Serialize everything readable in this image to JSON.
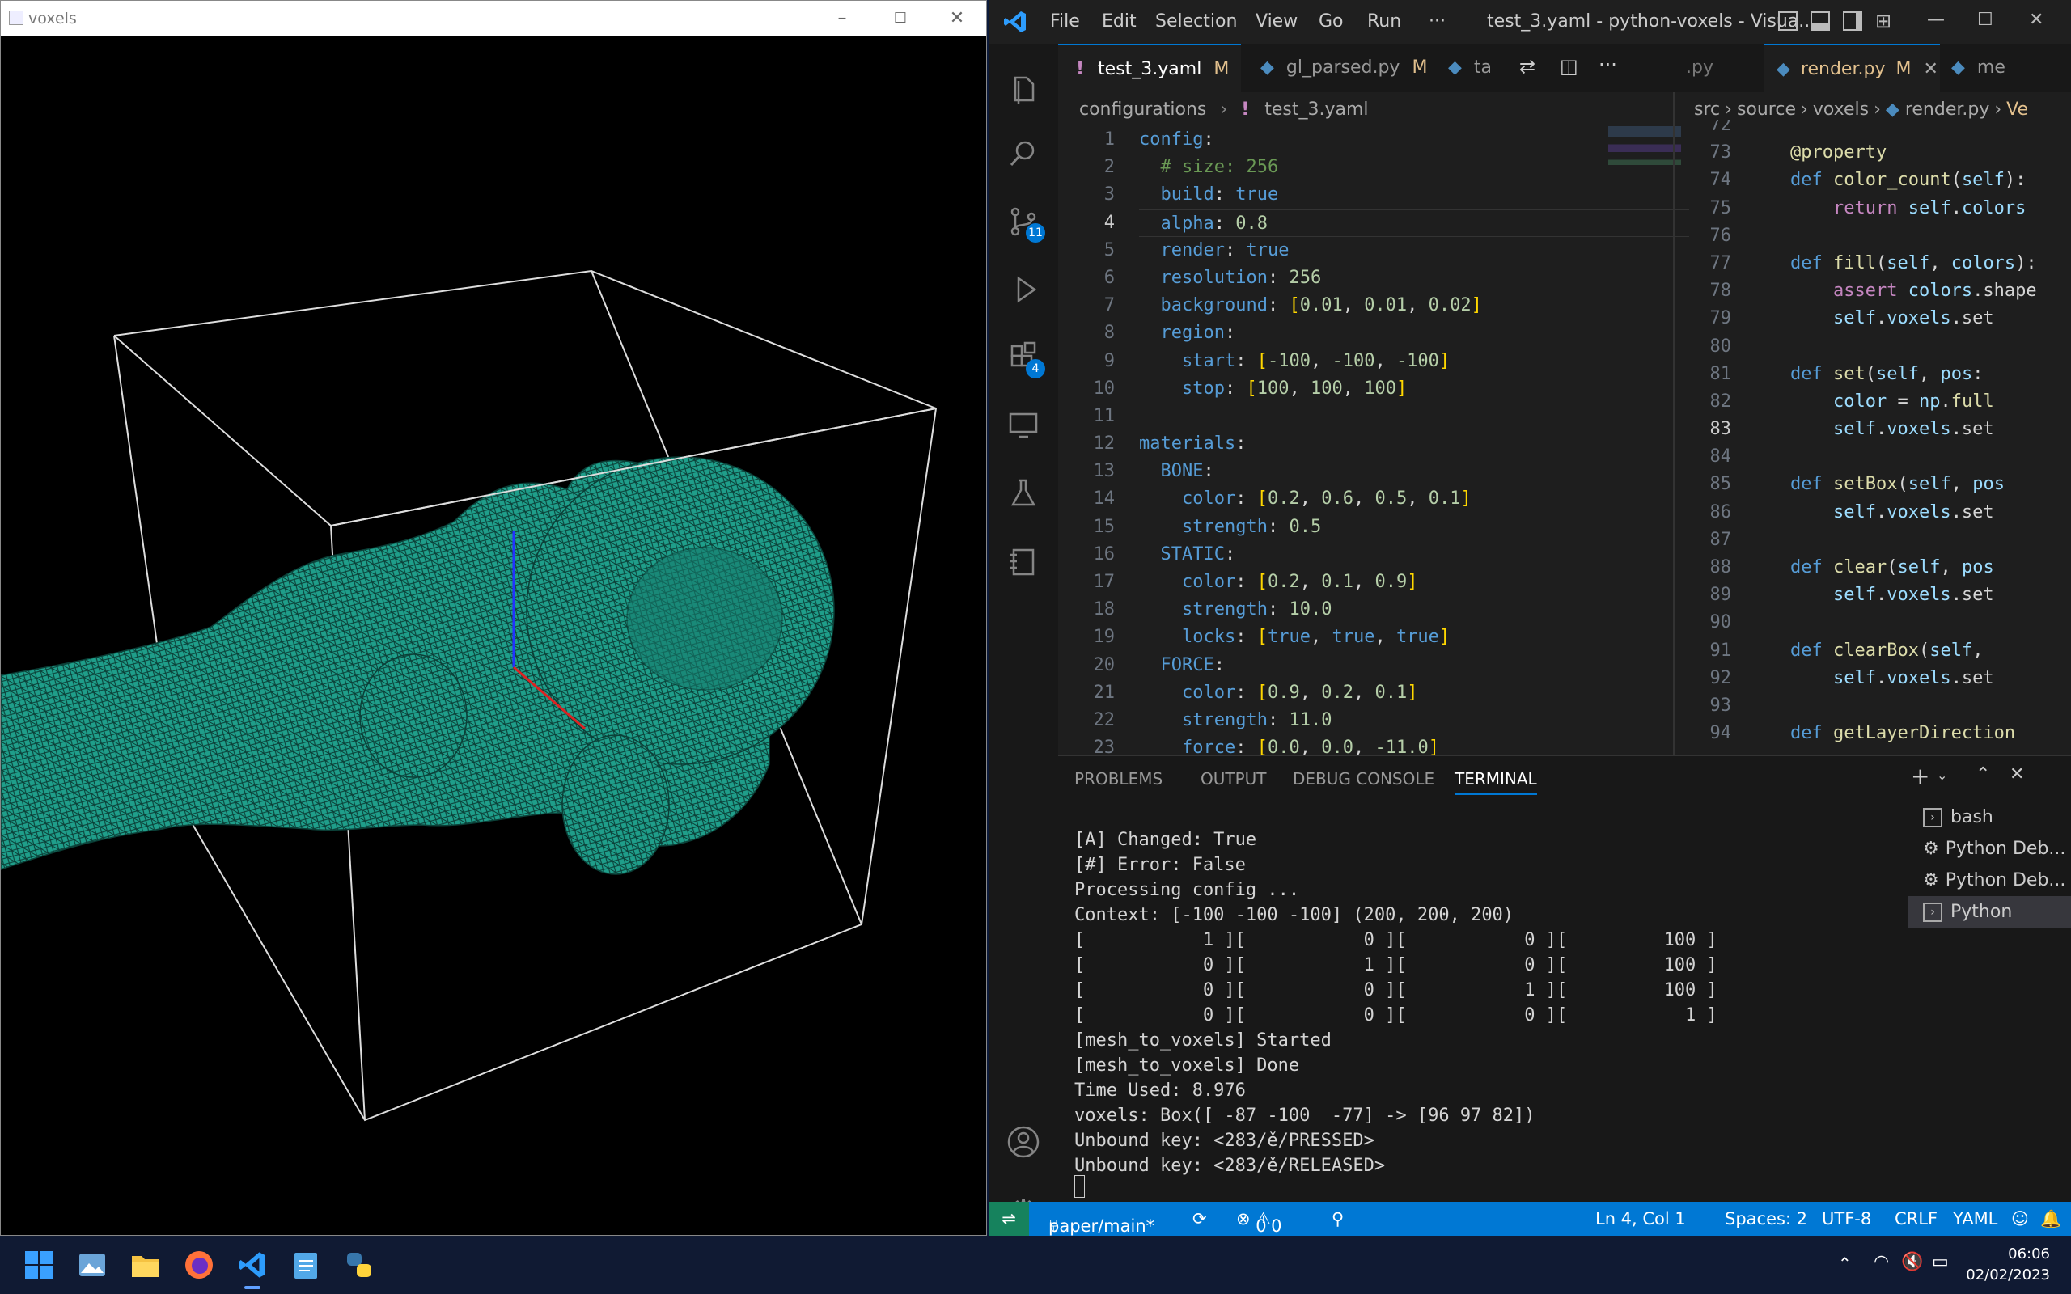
{
  "voxels_window": {
    "title": "voxels",
    "minimize": "–",
    "maximize": "☐",
    "close": "✕"
  },
  "vscode": {
    "menu": [
      "File",
      "Edit",
      "Selection",
      "View",
      "Go",
      "Run",
      "···"
    ],
    "title": "test_3.yaml - python-voxels - Visua...",
    "left_tabs": [
      {
        "icon": "!",
        "label": "test_3.yaml",
        "status": "M",
        "active": true
      },
      {
        "icon": "py",
        "label": "gl_parsed.py",
        "status": "M",
        "active": false
      },
      {
        "icon": "py",
        "label": "ta",
        "status": "",
        "active": false
      }
    ],
    "right_tabs": [
      {
        "label": ".py"
      },
      {
        "label": "render.py",
        "status": "M",
        "active": true
      },
      {
        "label": "me"
      }
    ],
    "left_breadcrumb": [
      "configurations",
      "!",
      "test_3.yaml"
    ],
    "right_breadcrumb": [
      "src",
      "source",
      "voxels",
      "render.py",
      "Ve"
    ],
    "left_line_numbers": [
      "1",
      "2",
      "3",
      "4",
      "5",
      "6",
      "7",
      "8",
      "9",
      "10",
      "11",
      "12",
      "13",
      "14",
      "15",
      "16",
      "17",
      "18",
      "19",
      "20",
      "21",
      "22",
      "23"
    ],
    "right_line_numbers": [
      "72",
      "73",
      "74",
      "75",
      "76",
      "77",
      "78",
      "79",
      "80",
      "81",
      "82",
      "83",
      "84",
      "85",
      "86",
      "87",
      "88",
      "89",
      "90",
      "91",
      "92",
      "93",
      "94"
    ],
    "panel_tabs": [
      "PROBLEMS",
      "OUTPUT",
      "DEBUG CONSOLE",
      "TERMINAL"
    ],
    "terminal_lines": [
      "[A] Changed: True",
      "[#] Error: False",
      "Processing config ...",
      "Context: [-100 -100 -100] (200, 200, 200)",
      "[           1 ][           0 ][           0 ][         100 ]",
      "[           0 ][           1 ][           0 ][         100 ]",
      "[           0 ][           0 ][           1 ][         100 ]",
      "[           0 ][           0 ][           0 ][           1 ]",
      "[mesh_to_voxels] Started",
      "[mesh_to_voxels] Done",
      "Time Used: 8.976",
      "voxels: Box([ -87 -100  -77] -> [96 97 82])",
      "Unbound key: <283/ě/PRESSED>",
      "Unbound key: <283/ě/RELEASED>"
    ],
    "terminal_list": [
      "bash",
      "Python Deb...",
      "Python Deb...",
      "Python"
    ],
    "status": {
      "branch": "paper/main*",
      "errors": "0",
      "warnings": "0",
      "position": "Ln 4, Col 1",
      "spaces": "Spaces: 2",
      "encoding": "UTF-8",
      "eol": "CRLF",
      "language": "YAML"
    },
    "badges": {
      "scm": "11",
      "extensions": "4"
    }
  },
  "taskbar": {
    "time": "06:06",
    "date": "02/02/2023"
  },
  "colors": {
    "mesh": "#1f9e8a",
    "accent": "#0078d4"
  }
}
